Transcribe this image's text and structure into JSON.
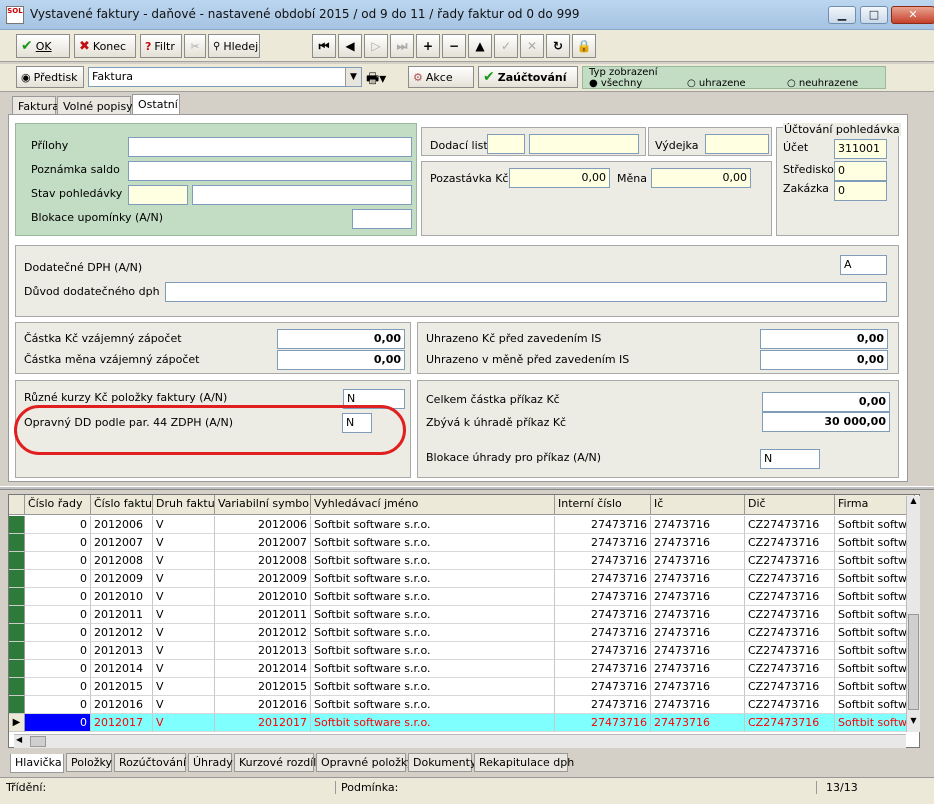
{
  "window": {
    "title": "Vystavené faktury - daňové - nastavené období 2015 / od 9 do 11 / řady faktur od 0 do 999",
    "logo_text": "SOL"
  },
  "toolbar": {
    "ok": "OK",
    "konec": "Konec",
    "filtr": "Filtr",
    "hledej": "Hledej"
  },
  "row2": {
    "predtisk": "Předtisk",
    "form_value": "Faktura",
    "akce": "Akce",
    "zauctovani": "Zaúčtování",
    "typ_zobrazeni": "Typ zobrazení",
    "opt_vsechny": "všechny",
    "opt_uhrazene": "uhrazene",
    "opt_neuhrazene": "neuhrazene"
  },
  "tabs": [
    "Faktura",
    "Volné popisy",
    "Ostatní"
  ],
  "form": {
    "prilohy": "Přílohy",
    "poznamka_saldo": "Poznámka saldo",
    "stav_pohledavky": "Stav pohledávky",
    "blokace_upominky": "Blokace upomínky (A/N)",
    "dodaci_list": "Dodací list",
    "vydejka": "Výdejka",
    "pozastavka_kc": "Pozastávka Kč",
    "pozastavka_val": "0,00",
    "mena": "Měna",
    "mena_val": "0,00",
    "uctovani_title": "Účtování pohledávka",
    "ucet": "Účet",
    "ucet_val": "311001",
    "stredisko": "Středisko",
    "stredisko_val": "0",
    "zakazka": "Zakázka",
    "zakazka_val": "0",
    "dodatecne_dph": "Dodatečné DPH (A/N)",
    "dodatecne_dph_val": "A",
    "duvod_dph": "Důvod dodatečného dph",
    "castka_kc_zapocet": "Částka Kč vzájemný zápočet",
    "castka_kc_zapocet_val": "0,00",
    "castka_mena_zapocet": "Částka měna vzájemný zápočet",
    "castka_mena_zapocet_val": "0,00",
    "uhrazeno_kc_is": "Uhrazeno Kč před zavedením IS",
    "uhrazeno_kc_is_val": "0,00",
    "uhrazeno_mena_is": "Uhrazeno v měně před zavedením IS",
    "uhrazeno_mena_is_val": "0,00",
    "ruzne_kurzy": "Různé kurzy Kč položky faktury (A/N)",
    "ruzne_kurzy_val": "N",
    "opravny_dd": "Opravný DD podle par. 44 ZDPH (A/N)",
    "opravny_dd_val": "N",
    "celkem_prikaz": "Celkem částka příkaz Kč",
    "celkem_prikaz_val": "0,00",
    "zbyva_uhrade": "Zbývá k úhradě příkaz Kč",
    "zbyva_uhrade_val": "30 000,00",
    "blokace_uhrady": "Blokace úhrady pro příkaz (A/N)",
    "blokace_uhrady_val": "N"
  },
  "grid": {
    "headers": [
      "Číslo řady",
      "Číslo faktury",
      "Druh faktury",
      "Variabilní symbol",
      "Vyhledávací jméno",
      "Interní číslo",
      "Ič",
      "Dič",
      "Firma"
    ],
    "rows": [
      [
        "0",
        "2012006",
        "V",
        "2012006",
        "Softbit software s.r.o.",
        "27473716",
        "27473716",
        "CZ27473716",
        "Softbit softwa"
      ],
      [
        "0",
        "2012007",
        "V",
        "2012007",
        "Softbit software s.r.o.",
        "27473716",
        "27473716",
        "CZ27473716",
        "Softbit softwa"
      ],
      [
        "0",
        "2012008",
        "V",
        "2012008",
        "Softbit software s.r.o.",
        "27473716",
        "27473716",
        "CZ27473716",
        "Softbit softwa"
      ],
      [
        "0",
        "2012009",
        "V",
        "2012009",
        "Softbit software s.r.o.",
        "27473716",
        "27473716",
        "CZ27473716",
        "Softbit softwa"
      ],
      [
        "0",
        "2012010",
        "V",
        "2012010",
        "Softbit software s.r.o.",
        "27473716",
        "27473716",
        "CZ27473716",
        "Softbit softwa"
      ],
      [
        "0",
        "2012011",
        "V",
        "2012011",
        "Softbit software s.r.o.",
        "27473716",
        "27473716",
        "CZ27473716",
        "Softbit softwa"
      ],
      [
        "0",
        "2012012",
        "V",
        "2012012",
        "Softbit software s.r.o.",
        "27473716",
        "27473716",
        "CZ27473716",
        "Softbit softwa"
      ],
      [
        "0",
        "2012013",
        "V",
        "2012013",
        "Softbit software s.r.o.",
        "27473716",
        "27473716",
        "CZ27473716",
        "Softbit softwa"
      ],
      [
        "0",
        "2012014",
        "V",
        "2012014",
        "Softbit software s.r.o.",
        "27473716",
        "27473716",
        "CZ27473716",
        "Softbit softwa"
      ],
      [
        "0",
        "2012015",
        "V",
        "2012015",
        "Softbit software s.r.o.",
        "27473716",
        "27473716",
        "CZ27473716",
        "Softbit softwa"
      ],
      [
        "0",
        "2012016",
        "V",
        "2012016",
        "Softbit software s.r.o.",
        "27473716",
        "27473716",
        "CZ27473716",
        "Softbit softwa"
      ],
      [
        "0",
        "2012017",
        "V",
        "2012017",
        "Softbit software s.r.o.",
        "27473716",
        "27473716",
        "CZ27473716",
        "Softbit softwa"
      ]
    ]
  },
  "bottom_tabs": [
    "Hlavička",
    "Položky",
    "Rozúčtování",
    "Úhrady",
    "Kurzové rozdíly",
    "Opravné položky",
    "Dokumenty",
    "Rekapitulace dph"
  ],
  "status": {
    "trideni": "Třídění:",
    "podminka": "Podmínka:",
    "count": "13/13"
  },
  "colors": {
    "selected_row": "#80ffff",
    "selected_text": "#ff0000",
    "panel_green": "#c3dcc4",
    "annotation": "#e02020",
    "input_yellow": "#ffffe1"
  }
}
